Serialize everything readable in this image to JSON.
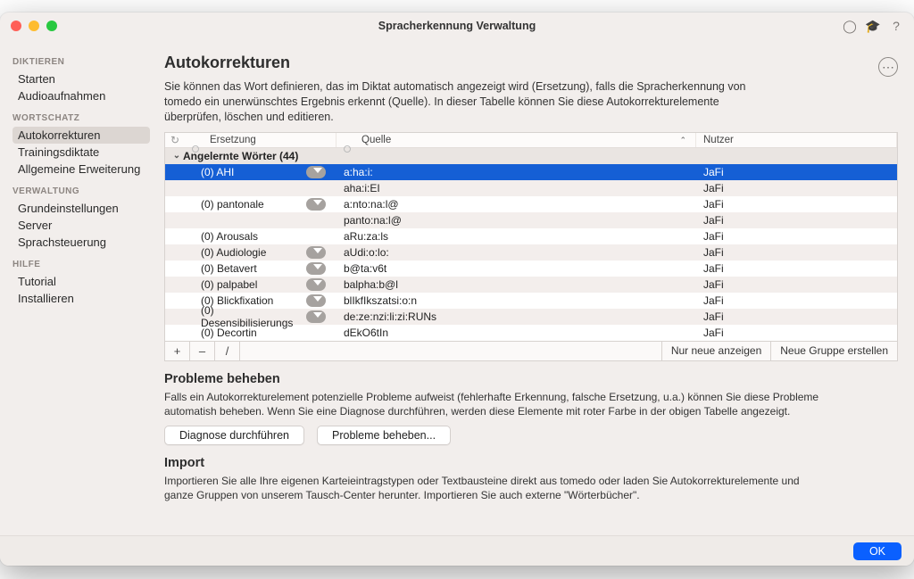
{
  "window": {
    "title": "Spracherkennung Verwaltung"
  },
  "sidebar": {
    "groups": [
      {
        "head": "DIKTIEREN",
        "items": [
          {
            "label": "Starten"
          },
          {
            "label": "Audioaufnahmen"
          }
        ]
      },
      {
        "head": "WORTSCHATZ",
        "items": [
          {
            "label": "Autokorrekturen",
            "active": true
          },
          {
            "label": "Trainingsdiktate"
          },
          {
            "label": "Allgemeine Erweiterung"
          }
        ]
      },
      {
        "head": "VERWALTUNG",
        "items": [
          {
            "label": "Grundeinstellungen"
          },
          {
            "label": "Server"
          },
          {
            "label": "Sprachsteuerung"
          }
        ]
      },
      {
        "head": "HILFE",
        "items": [
          {
            "label": "Tutorial"
          },
          {
            "label": "Installieren"
          }
        ]
      }
    ]
  },
  "page": {
    "title": "Autokorrekturen",
    "description": "Sie können das Wort definieren, das im Diktat automatisch angezeigt wird (Ersetzung), falls die Spracherkennung von tomedo ein unerwünschtes Ergebnis erkennt (Quelle). In dieser Tabelle können Sie diese Autokorrekturelemente überprüfen, löschen und editieren."
  },
  "table": {
    "headers": {
      "c1": "Ersetzung",
      "c2": "Quelle",
      "c3": "Nutzer"
    },
    "group": "Angelernte Wörter (44)",
    "rows": [
      {
        "sel": true,
        "c1": "(0) AHI",
        "pill": true,
        "c2": "a:ha:i:",
        "c3": "JaFi"
      },
      {
        "alt": true,
        "c1": "",
        "pill": false,
        "c2": "aha:i:EI",
        "c3": "JaFi"
      },
      {
        "c1": "(0) pantonale",
        "pill": true,
        "c2": "a:nto:na:l@",
        "c3": "JaFi"
      },
      {
        "alt": true,
        "c1": "",
        "pill": false,
        "c2": "panto:na:l@",
        "c3": "JaFi"
      },
      {
        "c1": "(0) Arousals",
        "pill": false,
        "c2": "aRu:za:ls",
        "c3": "JaFi"
      },
      {
        "alt": true,
        "c1": "(0) Audiologie",
        "pill": true,
        "c2": "aUdi:o:lo:",
        "c3": "JaFi"
      },
      {
        "c1": "(0) Betavert",
        "pill": true,
        "c2": "b@ta:v6t",
        "c3": "JaFi"
      },
      {
        "alt": true,
        "c1": "(0) palpabel",
        "pill": true,
        "c2": "balpha:b@l",
        "c3": "JaFi"
      },
      {
        "c1": "(0) Blickfixation",
        "pill": true,
        "c2": "blIkfIkszatsi:o:n",
        "c3": "JaFi"
      },
      {
        "alt": true,
        "c1": "(0) Desensibilisierungs",
        "pill": true,
        "c2": "de:ze:nzi:li:zi:RUNs",
        "c3": "JaFi"
      },
      {
        "c1": "(0) Decortin",
        "pill": false,
        "c2": "dEkO6tIn",
        "c3": "JaFi"
      }
    ],
    "footer": {
      "add": "+",
      "remove": "–",
      "edit": "/",
      "show_new": "Nur neue anzeigen",
      "new_group": "Neue Gruppe erstellen"
    }
  },
  "problems": {
    "title": "Probleme beheben",
    "body": "Falls ein Autokorrekturelement potenzielle Probleme aufweist (fehlerhafte Erkennung, falsche Ersetzung, u.a.) können Sie diese Probleme automatish beheben. Wenn Sie eine Diagnose durchführen, werden diese Elemente mit roter Farbe in der obigen Tabelle angezeigt.",
    "diagnose": "Diagnose durchführen",
    "fix": "Probleme beheben..."
  },
  "import": {
    "title": "Import",
    "body": "Importieren Sie alle Ihre eigenen Karteieintragstypen oder Textbausteine direkt aus tomedo oder laden Sie Autokorrekturelemente und ganze Gruppen von unserem Tausch-Center herunter. Importieren Sie auch externe \"Wörterbücher\"."
  },
  "ok": "OK"
}
